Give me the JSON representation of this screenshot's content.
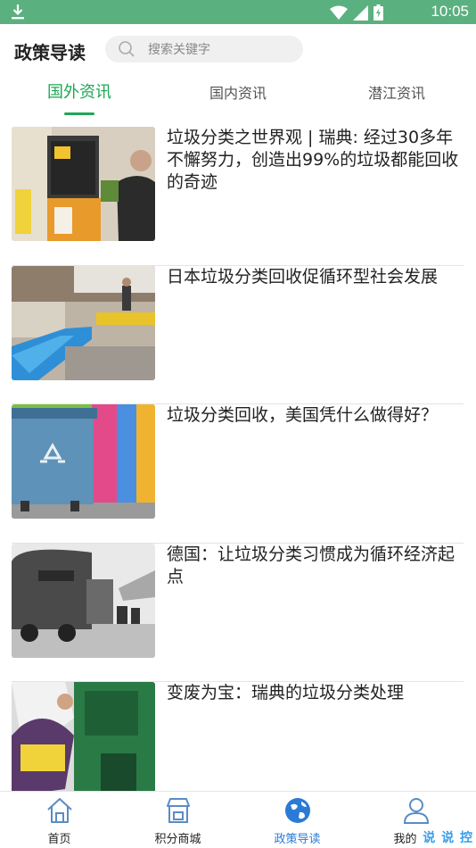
{
  "status_bar": {
    "time": "10:05",
    "icons": [
      "download-icon",
      "wifi-icon",
      "signal-icon",
      "battery-icon"
    ]
  },
  "header": {
    "title": "政策导读",
    "search": {
      "placeholder": "搜索关键字",
      "icon": "search-icon"
    }
  },
  "tabs": [
    {
      "label": "国外资讯",
      "active": true
    },
    {
      "label": "国内资讯",
      "active": false
    },
    {
      "label": "潜江资讯",
      "active": false
    }
  ],
  "news": [
    {
      "title": "垃圾分类之世界观 | 瑞典: 经过30多年不懈努力，创造出99%的垃圾都能回收的奇迹"
    },
    {
      "title": "日本垃圾分类回收促循环型社会发展"
    },
    {
      "title": "垃圾分类回收，美国凭什么做得好？"
    },
    {
      "title": "德国：让垃圾分类习惯成为循环经济起点"
    },
    {
      "title": "变废为宝：瑞典的垃圾分类处理"
    }
  ],
  "bottom_nav": [
    {
      "label": "首页",
      "icon": "home-icon",
      "active": false
    },
    {
      "label": "积分商城",
      "icon": "store-icon",
      "active": false
    },
    {
      "label": "政策导读",
      "icon": "globe-icon",
      "active": true
    },
    {
      "label": "我的",
      "icon": "user-icon",
      "active": false
    }
  ],
  "watermark": "说 说 控",
  "colors": {
    "status_bar": "#5bb07f",
    "accent_green": "#1ea755",
    "active_nav_blue": "#2a7bd6"
  }
}
